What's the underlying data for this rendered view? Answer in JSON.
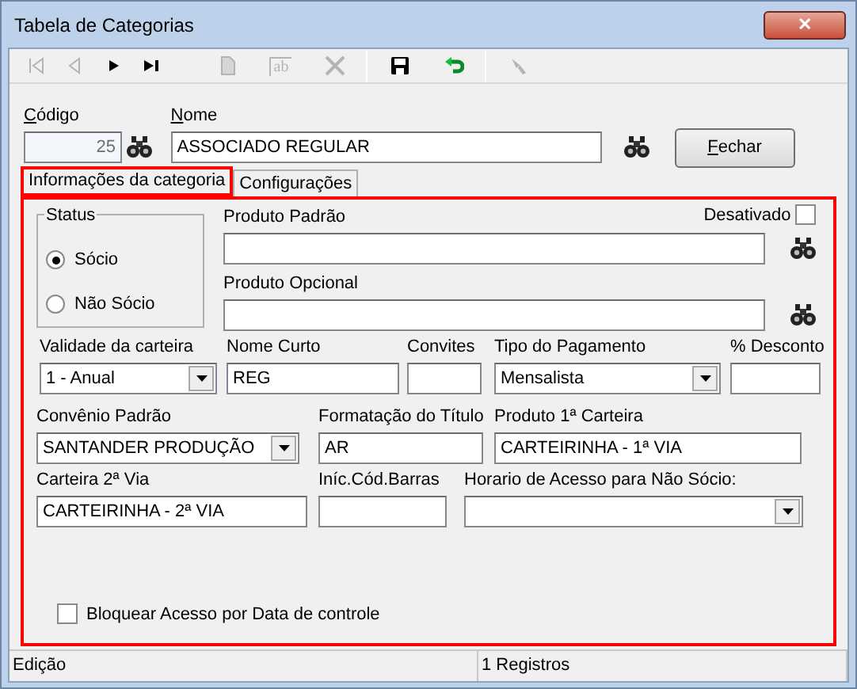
{
  "window": {
    "title": "Tabela de Categorias",
    "close": "✕"
  },
  "toolbar": [
    {
      "kind": "first",
      "disabled": true
    },
    {
      "kind": "prev",
      "disabled": true
    },
    {
      "kind": "next",
      "disabled": false
    },
    {
      "kind": "last",
      "disabled": false
    },
    {
      "kind": "new",
      "disabled": true
    },
    {
      "kind": "edit",
      "disabled": true,
      "label": "ab"
    },
    {
      "kind": "delete",
      "disabled": true
    },
    {
      "kind": "separator"
    },
    {
      "kind": "save",
      "disabled": false
    },
    {
      "kind": "undo",
      "disabled": false
    },
    {
      "kind": "separator"
    },
    {
      "kind": "filter",
      "disabled": true
    }
  ],
  "codigo": {
    "label": "Código",
    "value": "25",
    "disabled": true
  },
  "nome": {
    "label": "Nome",
    "value": "ASSOCIADO REGULAR"
  },
  "close_button": "Fechar",
  "tabs": [
    {
      "label": "Informações da categoria",
      "selected": true,
      "highlighted": true
    },
    {
      "label": "Configurações",
      "selected": false,
      "highlighted": false
    }
  ],
  "panel": {
    "highlighted": true,
    "status": {
      "label": "Status",
      "options": [
        {
          "label": "Sócio",
          "selected": true
        },
        {
          "label": "Não Sócio",
          "selected": false
        }
      ]
    },
    "desativado": {
      "label": "Desativado",
      "checked": false
    },
    "produto_padrao": {
      "label": "Produto Padrão"
    },
    "produto_opcional": {
      "label": "Produto Opcional"
    },
    "rows": [
      [
        {
          "label": "Validade da carteira",
          "value": "1 - Anual",
          "kind": "select"
        },
        {
          "label": "Nome Curto",
          "value": "REG",
          "kind": "text"
        },
        {
          "label": "Convites",
          "kind": "text"
        },
        {
          "label": "Tipo do Pagamento",
          "value": "Mensalista",
          "kind": "select"
        },
        {
          "label": "% Desconto",
          "kind": "text"
        }
      ],
      [
        {
          "label": "Convênio Padrão",
          "value": "SANTANDER PRODUÇÃO",
          "kind": "select"
        },
        {
          "label": "Formatação do Título",
          "value": "AR",
          "kind": "text"
        },
        {
          "label": "Produto 1ª Carteira",
          "value": "CARTEIRINHA - 1ª VIA",
          "kind": "text"
        }
      ],
      [
        {
          "label": "Carteira 2ª Via",
          "value": "CARTEIRINHA - 2ª VIA",
          "kind": "text"
        },
        {
          "label": "Iníc.Cód.Barras",
          "kind": "text"
        },
        {
          "label": "Horario de Acesso para Não Sócio:",
          "kind": "select"
        }
      ]
    ],
    "bloquear": {
      "label": "Bloquear Acesso por Data de controle",
      "checked": false
    }
  },
  "status_bar": [
    "Edição",
    "1 Registros"
  ]
}
